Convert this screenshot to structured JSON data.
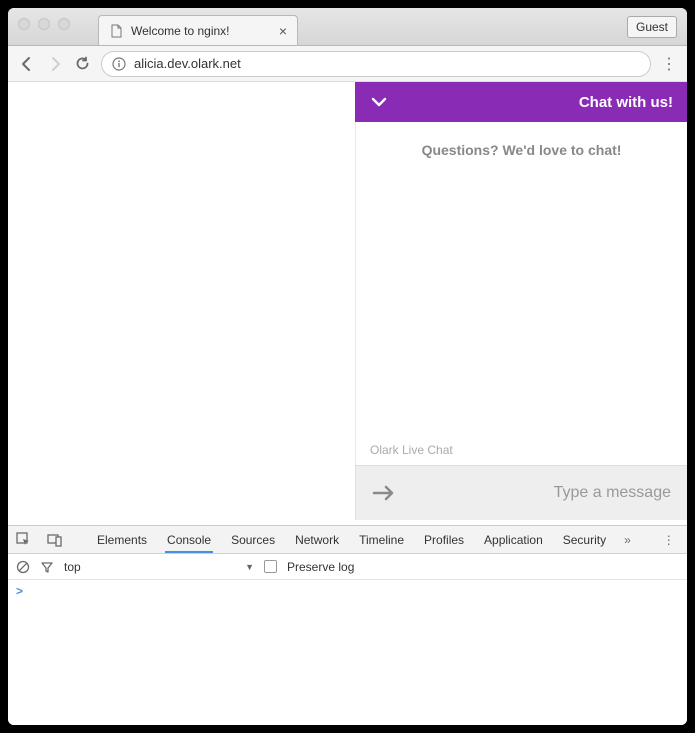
{
  "browser": {
    "tab_title": "Welcome to nginx!",
    "guest_label": "Guest",
    "url": "alicia.dev.olark.net"
  },
  "chat": {
    "header_title": "Chat with us!",
    "prompt": "Questions? We'd love to chat!",
    "brand": "Olark Live Chat",
    "input_placeholder": "Type a message"
  },
  "devtools": {
    "tabs": {
      "elements": "Elements",
      "console": "Console",
      "sources": "Sources",
      "network": "Network",
      "timeline": "Timeline",
      "profiles": "Profiles",
      "application": "Application",
      "security": "Security"
    },
    "context": "top",
    "preserve_log_label": "Preserve log",
    "prompt_caret": ">"
  }
}
